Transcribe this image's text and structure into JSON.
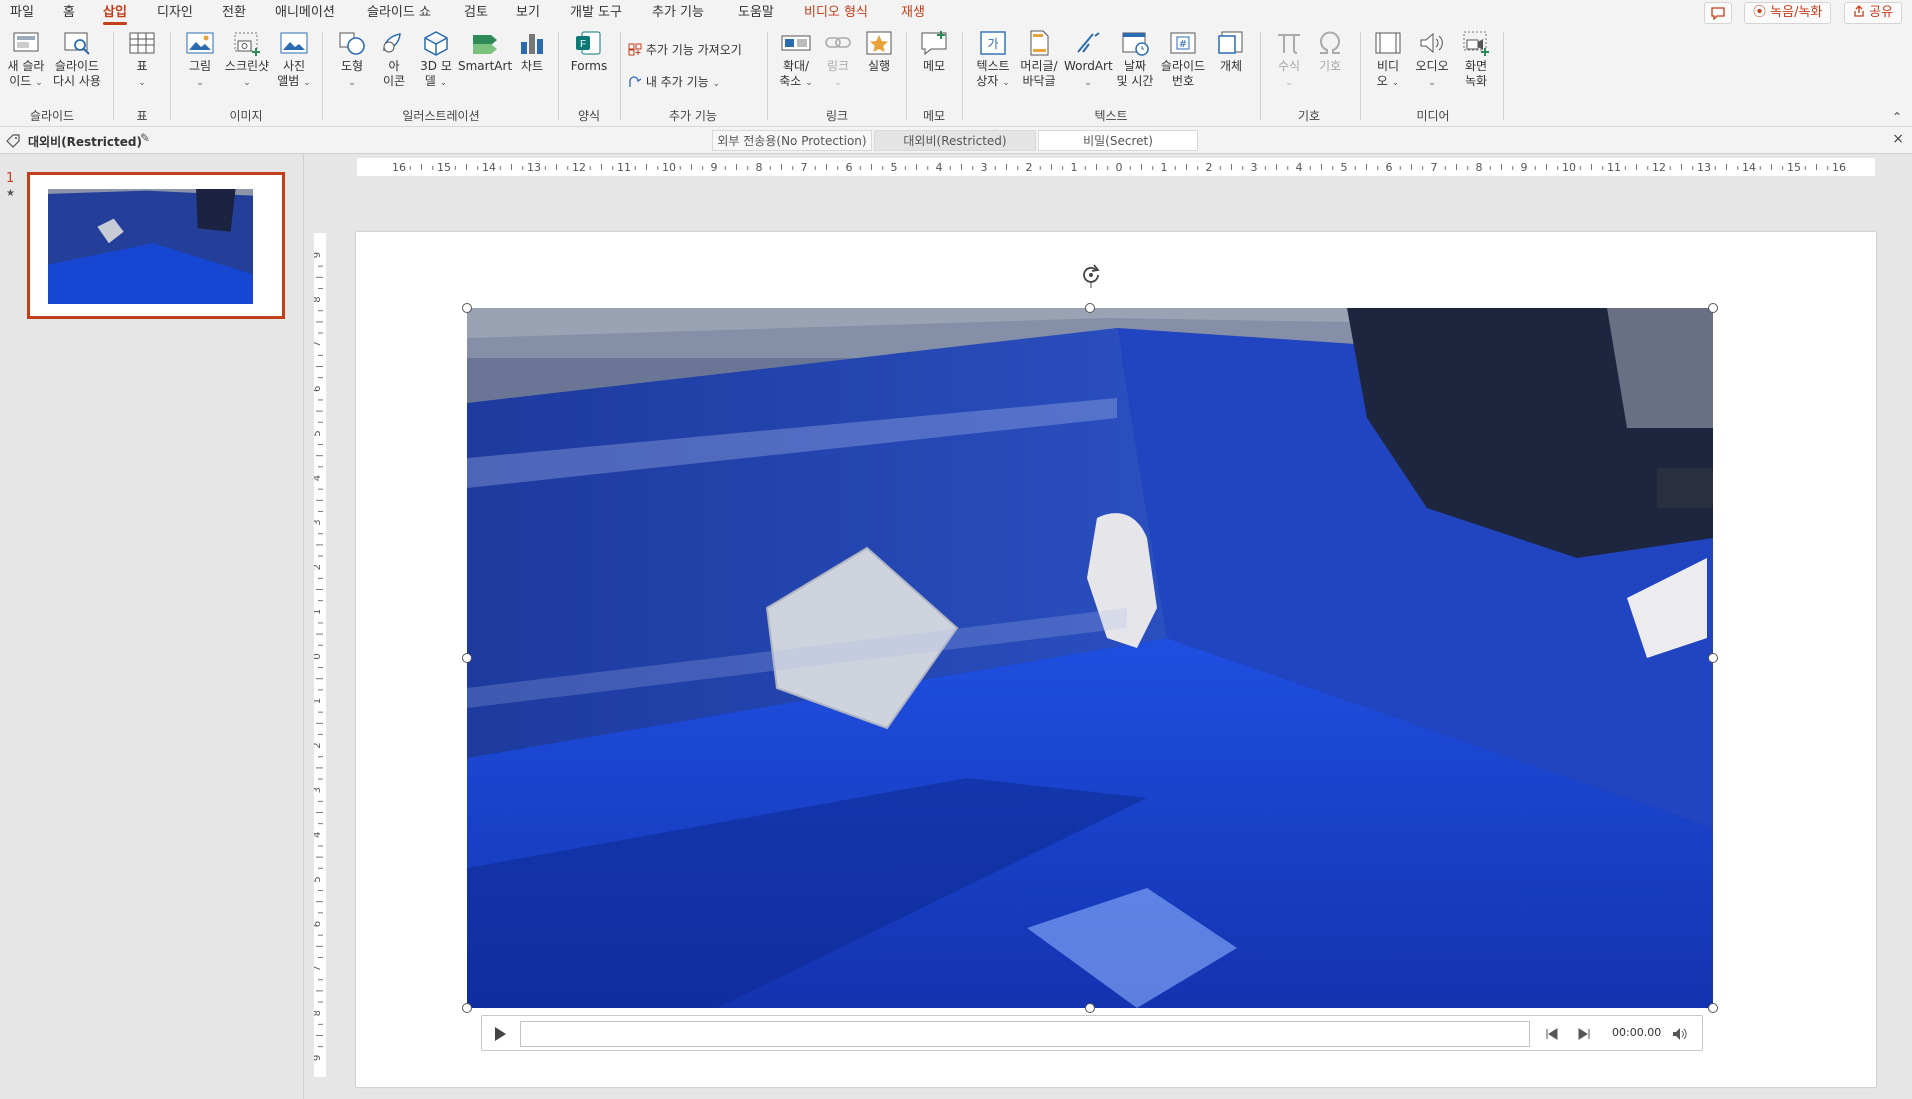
{
  "tabs": [
    {
      "label": "파일"
    },
    {
      "label": "홈"
    },
    {
      "label": "삽입"
    },
    {
      "label": "디자인"
    },
    {
      "label": "전환"
    },
    {
      "label": "애니메이션"
    },
    {
      "label": "슬라이드 쇼"
    },
    {
      "label": "검토"
    },
    {
      "label": "보기"
    },
    {
      "label": "개발 도구"
    },
    {
      "label": "추가 기능"
    },
    {
      "label": "도움말"
    },
    {
      "label": "비디오 형식"
    },
    {
      "label": "재생"
    }
  ],
  "topbar": {
    "record": "녹음/녹화",
    "share": "공유"
  },
  "ribbon": {
    "new_slide": [
      "새 슬라",
      "이드"
    ],
    "reuse_slide": [
      "슬라이드",
      "다시 사용"
    ],
    "table": "표",
    "picture": "그림",
    "screenshot": "스크린샷",
    "photo_album": [
      "사진",
      "앨범"
    ],
    "shapes": "도형",
    "icons": [
      "아",
      "이콘"
    ],
    "model3d": [
      "3D 모",
      "델"
    ],
    "smartart": "SmartArt",
    "chart": "차트",
    "forms": "Forms",
    "get_addins": "추가 기능 가져오기",
    "my_addins": "내 추가 기능",
    "zoom": [
      "확대/",
      "축소"
    ],
    "link": "링크",
    "action": "실행",
    "comment": "메모",
    "textbox": [
      "텍스트",
      "상자"
    ],
    "header_footer": [
      "머리글/",
      "바닥글"
    ],
    "wordart": "WordArt",
    "datetime": [
      "날짜",
      "및 시간"
    ],
    "slide_number": [
      "슬라이드",
      "번호"
    ],
    "object": "개체",
    "equation": "수식",
    "symbol": "기호",
    "video": [
      "비디",
      "오"
    ],
    "audio": "오디오",
    "screen_recording": [
      "화면",
      "녹화"
    ],
    "groups": {
      "slides": "슬라이드",
      "tables": "표",
      "images": "이미지",
      "illustrations": "일러스트레이션",
      "forms": "양식",
      "addins": "추가 기능",
      "links": "링크",
      "comments": "메모",
      "text": "텍스트",
      "symbols": "기호",
      "media": "미디어"
    }
  },
  "sensitivity": {
    "current": "대외비(Restricted)",
    "options": [
      "외부 전송용(No Protection)",
      "대외비(Restricted)",
      "비밀(Secret)"
    ]
  },
  "thumbs": {
    "number": "1",
    "star": "★"
  },
  "ruler": {
    "h_labels": [
      "16",
      "15",
      "14",
      "13",
      "12",
      "11",
      "10",
      "9",
      "8",
      "7",
      "6",
      "5",
      "4",
      "3",
      "2",
      "1",
      "0",
      "1",
      "2",
      "3",
      "4",
      "5",
      "6",
      "7",
      "8",
      "9",
      "10",
      "11",
      "12",
      "13",
      "14",
      "15",
      "16"
    ],
    "v_labels": [
      "9",
      "8",
      "7",
      "6",
      "5",
      "4",
      "3",
      "2",
      "1",
      "0",
      "1",
      "2",
      "3",
      "4",
      "5",
      "6",
      "7",
      "8",
      "9"
    ]
  },
  "player": {
    "time": "00:00.00",
    "progress": 0
  },
  "colors": {
    "accent": "#c43e1c",
    "ribbon_bg": "#f3f3f3",
    "tarp_blue": "#1a43c8"
  }
}
